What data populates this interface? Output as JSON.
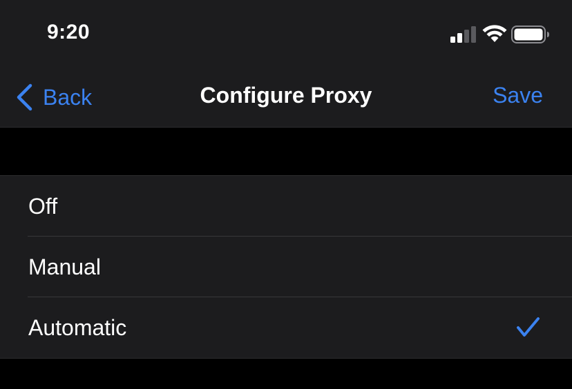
{
  "status_bar": {
    "time": "9:20",
    "signal_icon": "cellular-signal-icon",
    "wifi_icon": "wifi-icon",
    "battery_icon": "battery-icon"
  },
  "nav": {
    "back_label": "Back",
    "title": "Configure Proxy",
    "save_label": "Save"
  },
  "options": [
    {
      "label": "Off",
      "selected": false
    },
    {
      "label": "Manual",
      "selected": false
    },
    {
      "label": "Automatic",
      "selected": true
    }
  ],
  "colors": {
    "accent": "#3b82f0",
    "background": "#000000",
    "cell": "#1c1c1e",
    "text": "#ffffff"
  }
}
